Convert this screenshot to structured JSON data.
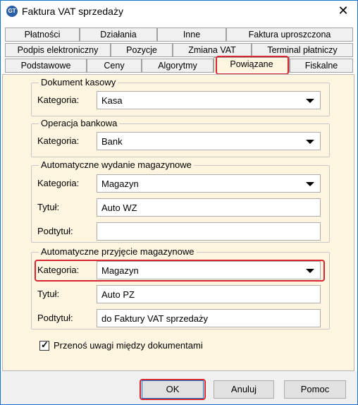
{
  "window": {
    "title": "Faktura VAT sprzedaży",
    "icon": "app-logo-icon",
    "close_icon": "close-icon"
  },
  "tabs": {
    "row1": [
      "Płatności",
      "Działania",
      "Inne",
      "Faktura uproszczona"
    ],
    "row2": [
      "Podpis elektroniczny",
      "Pozycje",
      "Zmiana VAT",
      "Terminal płatniczy"
    ],
    "row3": [
      "Podstawowe",
      "Ceny",
      "Algorytmy",
      "Powiązane",
      "Fiskalne"
    ],
    "active": "Powiązane"
  },
  "groups": {
    "cash": {
      "title": "Dokument kasowy",
      "category_label": "Kategoria:",
      "category_value": "Kasa"
    },
    "bank": {
      "title": "Operacja bankowa",
      "category_label": "Kategoria:",
      "category_value": "Bank"
    },
    "wz": {
      "title": "Automatyczne wydanie magazynowe",
      "category_label": "Kategoria:",
      "category_value": "Magazyn",
      "title_label": "Tytuł:",
      "title_value": "Auto WZ",
      "subtitle_label": "Podtytuł:",
      "subtitle_value": ""
    },
    "pz": {
      "title": "Automatyczne przyjęcie magazynowe",
      "category_label": "Kategoria:",
      "category_value": "Magazyn",
      "title_label": "Tytuł:",
      "title_value": "Auto PZ",
      "subtitle_label": "Podtytuł:",
      "subtitle_value": "do Faktury VAT sprzedaży"
    }
  },
  "checkbox": {
    "label": "Przenoś uwagi między dokumentami",
    "checked": true
  },
  "buttons": {
    "ok": "OK",
    "cancel": "Anuluj",
    "help": "Pomoc"
  },
  "colors": {
    "highlight": "#d9262e",
    "panel": "#fdf5e0",
    "accent": "#0078d7"
  }
}
